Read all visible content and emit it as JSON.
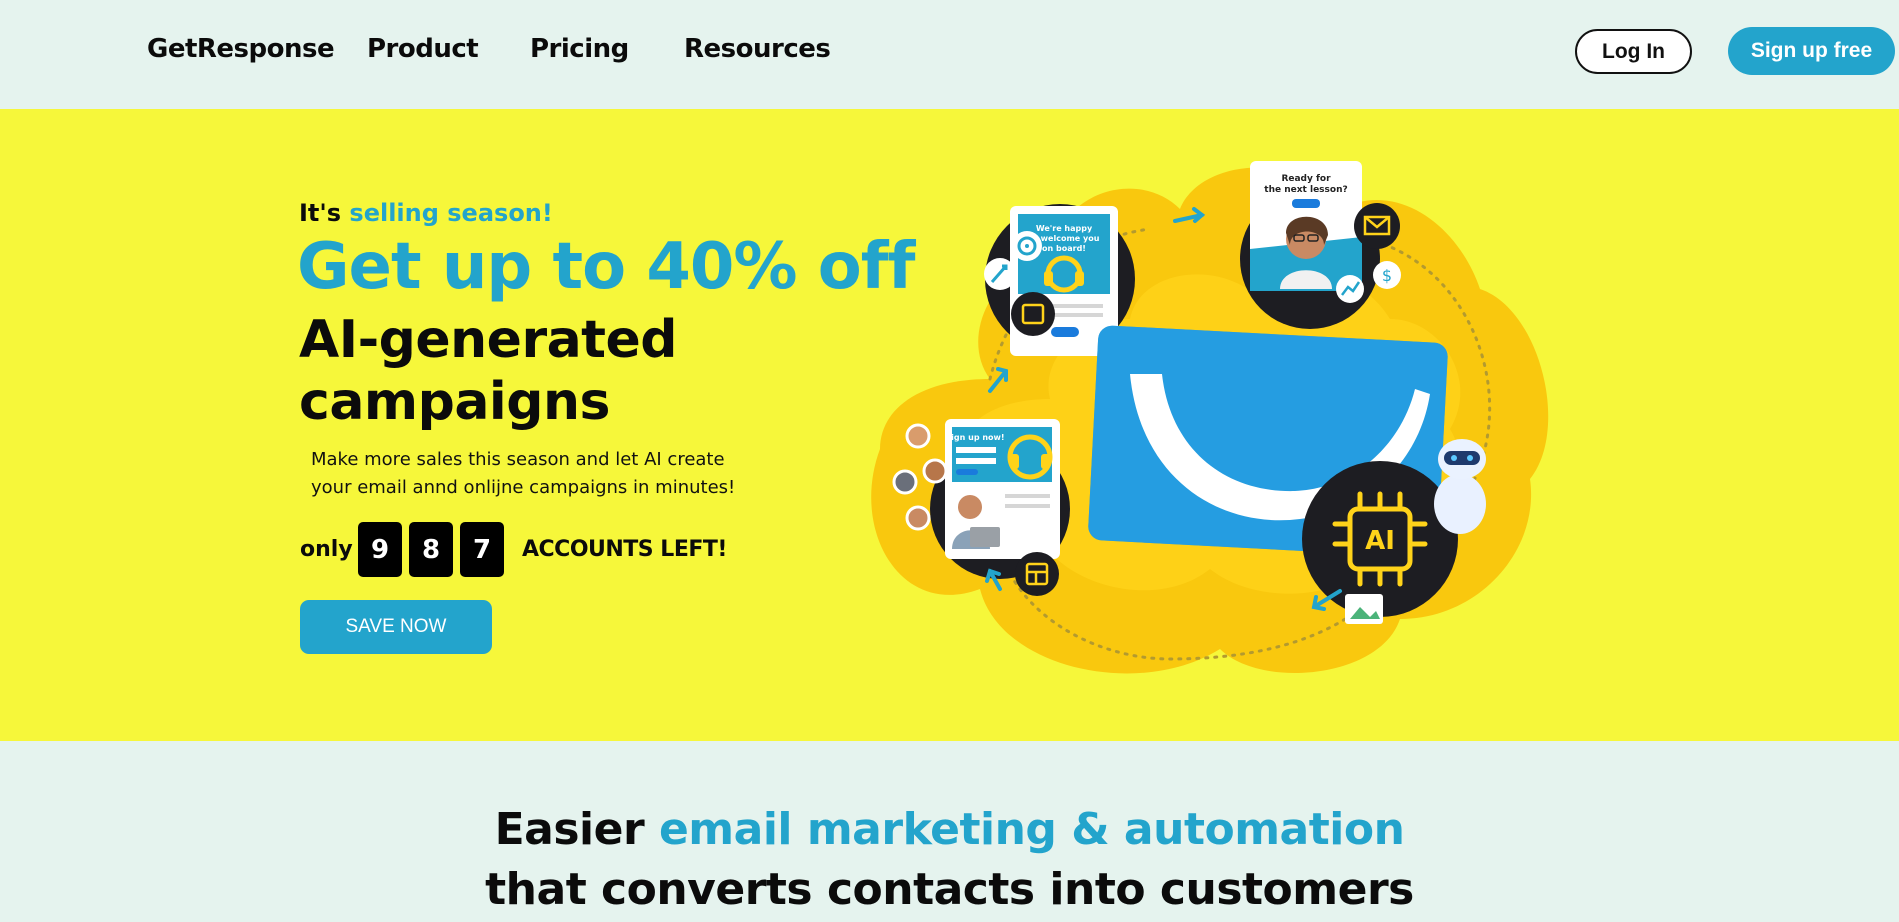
{
  "nav": {
    "brand": "GetResponse",
    "links": [
      "Product",
      "Pricing",
      "Resources"
    ],
    "login": "Log In",
    "signup": "Sign up free"
  },
  "hero": {
    "kicker_prefix": "It's",
    "kicker_highlight": "selling season!",
    "headline": "Get up to 40% off",
    "subheadline_line1": "AI-generated",
    "subheadline_line2": "campaigns",
    "description": "Make more sales this season and let AI create your email annd onlijne campaigns in minutes!",
    "counter_prefix": "only",
    "digits": [
      "9",
      "8",
      "7"
    ],
    "counter_suffix": "ACCOUNTS LEFT!",
    "cta": "SAVE NOW",
    "illustration": {
      "card1_text": "We're happy to welcome you on board!",
      "card2_text": "Ready for the next lesson?",
      "card3_text": "Sign up now!",
      "ai_chip": "AI"
    }
  },
  "section": {
    "title_prefix": "Easier",
    "title_highlight": "email marketing & automation",
    "title_line2": "that converts contacts into customers"
  },
  "colors": {
    "accent": "#23a4cc",
    "hero_bg": "#f6f73a",
    "page_bg": "#e5f3ee",
    "blob": "#f9c80e"
  }
}
